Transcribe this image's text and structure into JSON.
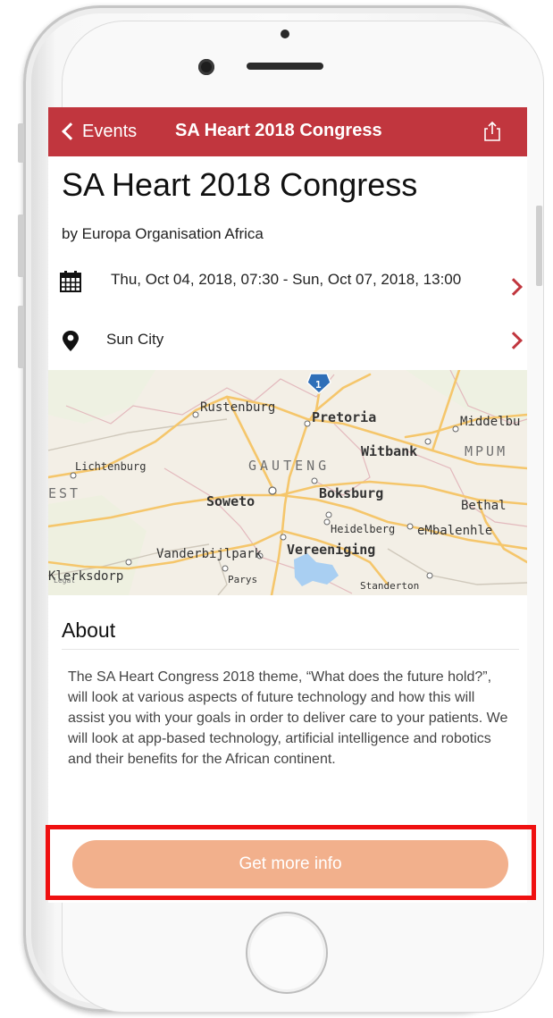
{
  "nav": {
    "back_label": "Events",
    "title": "SA Heart 2018 Congress",
    "share_icon": "share-icon"
  },
  "event": {
    "title": "SA Heart 2018 Congress",
    "organizer": "by Europa Organisation Africa",
    "date_range": "Thu, Oct 04, 2018, 07:30 - Sun, Oct 07, 2018, 13:00",
    "location": "Sun City"
  },
  "map": {
    "route_shield": "1",
    "labels": {
      "rustenburg": "Rustenburg",
      "pretoria": "Pretoria",
      "middelburg": "Middelbu",
      "witbank": "Witbank",
      "mpum": "MPUM",
      "lichtenburg": "Lichtenburg",
      "gauteng": "GAUTENG",
      "est": "EST",
      "soweto": "Soweto",
      "boksburg": "Boksburg",
      "bethal": "Bethal",
      "heidelberg": "Heidelberg",
      "embalenhle": "eMbalenhle",
      "vanderbijlpark": "Vanderbijlpark",
      "vereeniging": "Vereeniging",
      "klerksdorp": "Klerksdorp",
      "parys": "Parys",
      "standerton": "Standerton",
      "legal": "Legal"
    }
  },
  "about": {
    "heading": "About",
    "body": "The SA Heart Congress 2018 theme, “What does the future hold?”, will look at various aspects of future technology and how this will assist you with your goals in order to deliver care to your patients. We will look at app-based technology, artificial intelligence and robotics and their benefits for the African continent."
  },
  "cta": {
    "label": "Get more info"
  },
  "colors": {
    "brand_red": "#c1363e",
    "cta_peach": "#f2b08c",
    "highlight_red": "#ef1010"
  }
}
